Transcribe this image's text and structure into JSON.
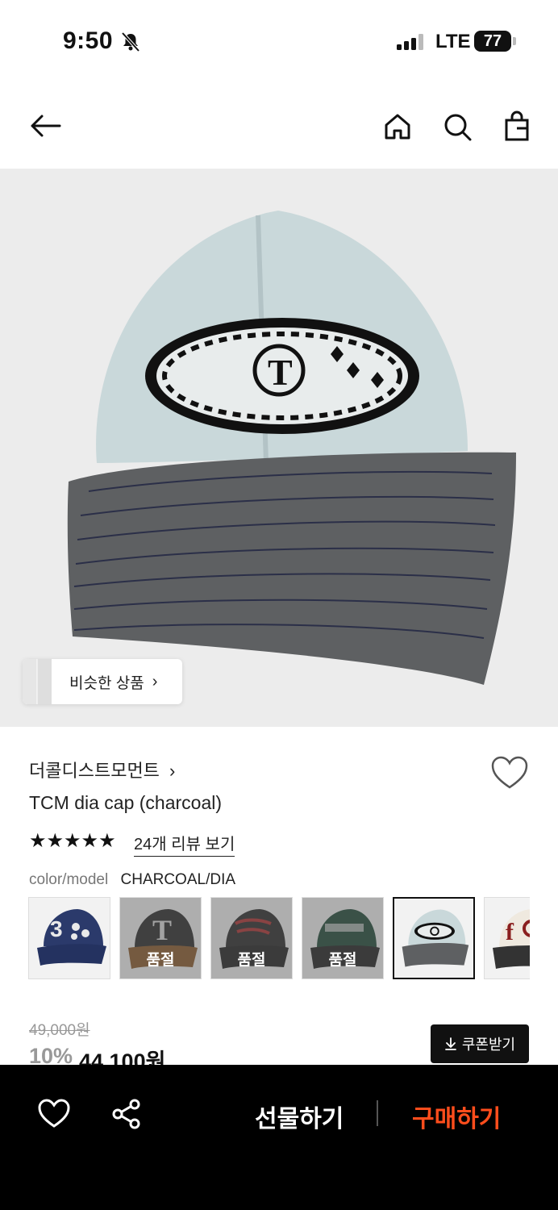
{
  "status": {
    "time": "9:50",
    "network": "LTE",
    "battery": "77"
  },
  "nav": {
    "icons": [
      "back-arrow-icon",
      "home-icon",
      "search-icon",
      "shopping-bag-icon"
    ]
  },
  "image": {
    "similar_label": "비슷한 상품",
    "similar_chevron": "›"
  },
  "product": {
    "brand": "더콜디스트모먼트",
    "brand_chevron": "›",
    "title": "TCM dia cap (charcoal)",
    "rating_stars": "★★★★★",
    "review_link": "24개 리뷰 보기",
    "option_label": "color/model",
    "option_value": "CHARCOAL/DIA"
  },
  "variants": [
    {
      "soldout": ""
    },
    {
      "soldout": "품절"
    },
    {
      "soldout": "품절"
    },
    {
      "soldout": "품절"
    },
    {
      "soldout": "",
      "selected": true
    },
    {
      "soldout": ""
    }
  ],
  "price": {
    "original": "49,000원",
    "discount": "10%",
    "final": "44,100원",
    "coupon_icon": "download-icon",
    "coupon_label": "쿠폰받기"
  },
  "bottom_bar": {
    "gift_label": "선물하기",
    "buy_label": "구매하기",
    "buy_color": "#ff4d1c"
  }
}
